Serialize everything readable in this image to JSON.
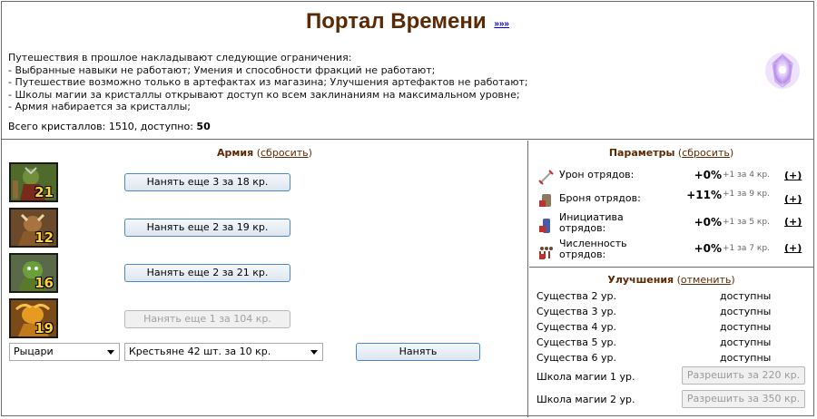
{
  "header": {
    "title": "Портал Времени",
    "more_link": "»»»",
    "description_lines": [
      "Путешествия в прошлое накладывают следующие ограничения:",
      "- Выбранные навыки не работают; Умения и способности фракций не работают;",
      "- Путешествие возможно только в артефактах из магазина; Улучшения артефактов не работают;",
      "- Школы магии за кристаллы открывают доступ ко всем заклинаниям на максимальном уровне;",
      "- Армия набирается за кристаллы;"
    ],
    "crystals_label": "Всего кристаллов: 1510, доступно: ",
    "crystals_available": "50"
  },
  "army": {
    "title": "Армия",
    "reset_open": " (",
    "reset_link": "сбросить",
    "reset_close": ")",
    "units": [
      {
        "count": "21",
        "button": "Нанять еще 3 за 18 кр.",
        "enabled": true
      },
      {
        "count": "12",
        "button": "Нанять еще 2 за 19 кр.",
        "enabled": true
      },
      {
        "count": "16",
        "button": "Нанять еще 2 за 21 кр.",
        "enabled": true
      },
      {
        "count": "19",
        "button": "Нанять еще 1 за 104 кр.",
        "enabled": false
      }
    ],
    "faction_select": "Рыцари",
    "unit_select": "Крестьяне 42 шт. за 10 кр.",
    "hire_button": "Нанять"
  },
  "params": {
    "title": "Параметры",
    "reset_open": " (",
    "reset_link": "сбросить",
    "reset_close": ")",
    "rows": [
      {
        "name": "Урон отрядов:",
        "value": "+0%",
        "inc": "+1 за 4 кр.",
        "plus": "(+)"
      },
      {
        "name": "Броня отрядов:",
        "value": "+11%",
        "inc": "+1 за 9 кр.",
        "plus": "(+)"
      },
      {
        "name": "Инициатива отрядов:",
        "value": "+0%",
        "inc": "+1 за 5 кр.",
        "plus": "(+)"
      },
      {
        "name": "Численность отрядов:",
        "value": "+0%",
        "inc": "+1 за 7 кр.",
        "plus": "(+)"
      }
    ]
  },
  "upgrades": {
    "title": "Улучшения",
    "cancel_open": " (",
    "cancel_link": "отменить",
    "cancel_close": ")",
    "creatures": [
      {
        "name": "Существа 2 ур.",
        "status": "доступны"
      },
      {
        "name": "Существа 3 ур.",
        "status": "доступны"
      },
      {
        "name": "Существа 4 ур.",
        "status": "доступны"
      },
      {
        "name": "Существа 5 ур.",
        "status": "доступны"
      },
      {
        "name": "Существа 6 ур.",
        "status": "доступны"
      }
    ],
    "schools": [
      {
        "name": "Школа магии 1 ур.",
        "button": "Разрешить за 220 кр."
      },
      {
        "name": "Школа магии 2 ур.",
        "button": "Разрешить за 350 кр."
      }
    ]
  },
  "colors": {
    "title_brown": "#5b2a05",
    "border": "#6b6b6b",
    "button_border": "#4c88c8",
    "count_yellow": "#ffd23a"
  },
  "icons": {
    "crystal": "crystal-icon",
    "damage": "sword-icon",
    "armor": "armor-icon",
    "initiative": "potion-icon",
    "quantity": "troops-icon"
  }
}
